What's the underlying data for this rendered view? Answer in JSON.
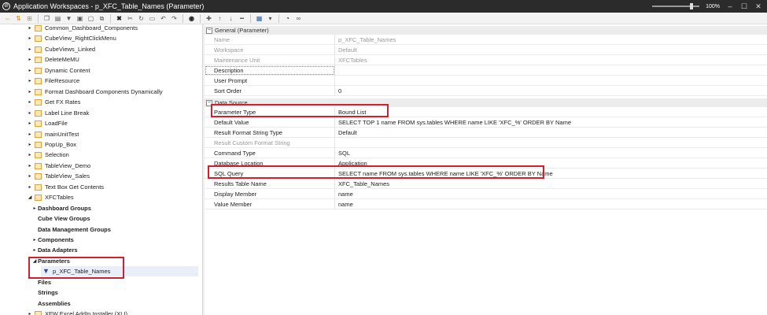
{
  "window": {
    "title": "Application Workspaces - p_XFC_Table_Names (Parameter)",
    "zoom": "100%",
    "zoom_level": 1.0
  },
  "toolbar": {
    "icons": [
      "expand-icon",
      "sort-icon",
      "hierarchy-icon",
      "copy-icon",
      "paste-icon",
      "filter-icon",
      "view-icon",
      "page-icon",
      "window-icon",
      "delete-icon",
      "cut-icon",
      "refresh-icon",
      "save-icon",
      "undo-icon",
      "redo-icon",
      "search-icon",
      "add-icon",
      "move-up-icon",
      "move-down-icon",
      "remove-icon",
      "document-icon",
      "dropdown-icon",
      "run-icon",
      "link-icon"
    ]
  },
  "tree": {
    "items": [
      {
        "label": "Common_Dashboard_Components",
        "bold": false
      },
      {
        "label": "CubeView_RightClickMenu",
        "bold": false
      },
      {
        "label": "CubeViews_Linked",
        "bold": false
      },
      {
        "label": "DeleteMeMU",
        "bold": false
      },
      {
        "label": "Dynamic Content",
        "bold": false
      },
      {
        "label": "FileResource",
        "bold": false
      },
      {
        "label": "Format Dashboard Components Dynamically",
        "bold": false
      },
      {
        "label": "Get FX Rates",
        "bold": false
      },
      {
        "label": "Label Line Break",
        "bold": false
      },
      {
        "label": "LoadFile",
        "bold": false
      },
      {
        "label": "mainUnitTest",
        "bold": false
      },
      {
        "label": "PopUp_Box",
        "bold": false
      },
      {
        "label": "Selection",
        "bold": false
      },
      {
        "label": "TableView_Demo",
        "bold": false
      },
      {
        "label": "TableView_Sales",
        "bold": false
      },
      {
        "label": "Text Box Get Contents",
        "bold": false
      },
      {
        "label": "XFCTables",
        "bold": false
      }
    ],
    "xfc_children": [
      {
        "label": "Dashboard Groups"
      },
      {
        "label": "Cube View Groups"
      },
      {
        "label": "Data Management Groups"
      },
      {
        "label": "Components"
      },
      {
        "label": "Data Adapters"
      },
      {
        "label": "Parameters"
      }
    ],
    "selected_parameter": "p_XFC_Table_Names",
    "after_children": [
      {
        "label": "Files"
      },
      {
        "label": "Strings"
      },
      {
        "label": "Assemblies"
      }
    ],
    "last_item": "XFW Excel AddIn Installer (XLI)"
  },
  "properties": {
    "general_category": "General (Parameter)",
    "general": [
      {
        "name": "Name",
        "value": "p_XFC_Table_Names",
        "muted": true
      },
      {
        "name": "Workspace",
        "value": "Default",
        "muted": true
      },
      {
        "name": "Maintenance Unit",
        "value": "XFCTables",
        "muted": true
      },
      {
        "name": "Description",
        "value": "",
        "muted": false
      },
      {
        "name": "User Prompt",
        "value": "",
        "muted": false
      },
      {
        "name": "Sort Order",
        "value": "0",
        "muted": false
      }
    ],
    "datasource_category": "Data Source",
    "datasource": [
      {
        "name": "Parameter Type",
        "value": "Bound List",
        "muted": false
      },
      {
        "name": "Default Value",
        "value": "SELECT TOP 1 name FROM sys.tables WHERE name LIKE 'XFC_%' ORDER BY Name",
        "muted": false
      },
      {
        "name": "Result Format String Type",
        "value": "Default",
        "muted": false
      },
      {
        "name": "Result Custom Format String",
        "value": "",
        "muted": true
      },
      {
        "name": "Command Type",
        "value": "SQL",
        "muted": false
      },
      {
        "name": "Database Location",
        "value": "Application",
        "muted": false
      },
      {
        "name": "SQL Query",
        "value": "SELECT name FROM sys.tables WHERE name LIKE 'XFC_%' ORDER BY Name",
        "muted": false
      },
      {
        "name": "Results Table Name",
        "value": "XFC_Table_Names",
        "muted": false
      },
      {
        "name": "Display Member",
        "value": "name",
        "muted": false
      },
      {
        "name": "Value Member",
        "value": "name",
        "muted": false
      }
    ]
  },
  "colors": {
    "highlight_red": "#d21f2e",
    "titlebar": "#2b2b2b",
    "folder": "#fbe9b9"
  }
}
